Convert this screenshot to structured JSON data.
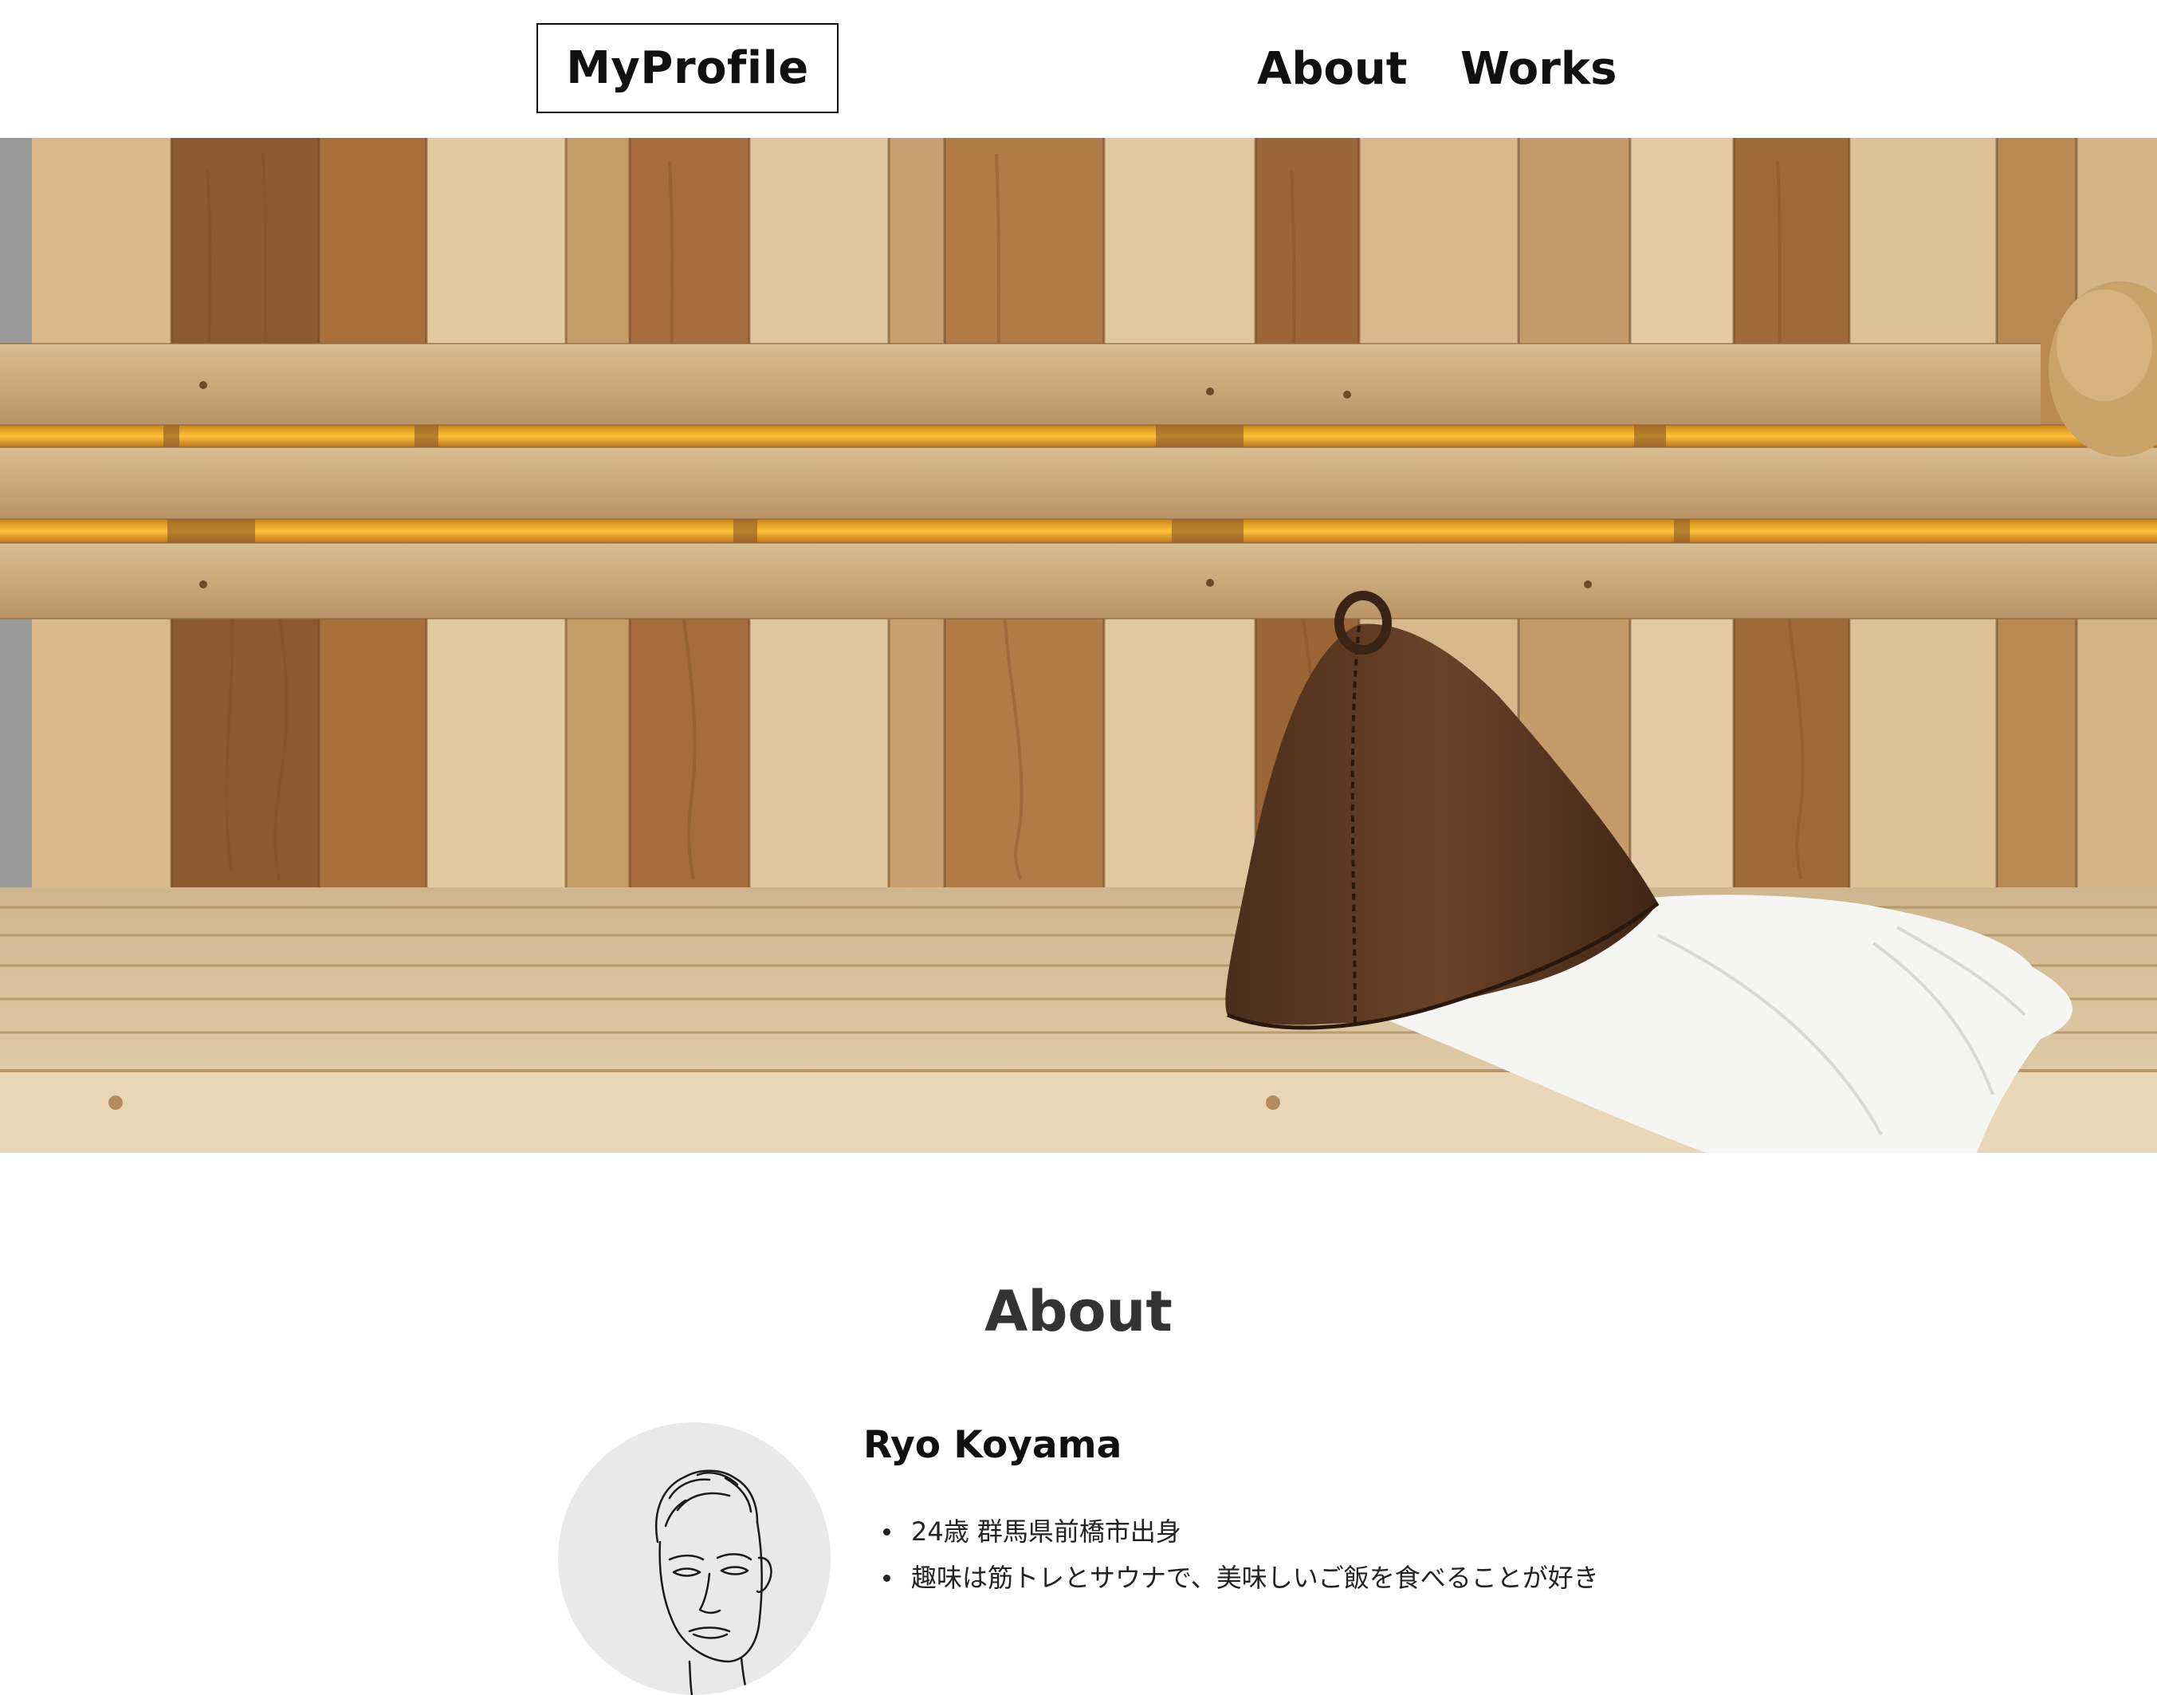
{
  "header": {
    "logo_text": "MyProfile",
    "nav": [
      {
        "label": "About"
      },
      {
        "label": "Works"
      }
    ]
  },
  "hero": {
    "subject": "sauna-bench-with-felt-hat-and-towel"
  },
  "about": {
    "title": "About",
    "name": "Ryo Koyama",
    "items": [
      "24歳 群馬県前橋市出身",
      "趣味は筋トレとサウナで、美味しいご飯を食べることが好き"
    ]
  },
  "colors": {
    "text": "#111111",
    "heading": "#333333",
    "background": "#ffffff",
    "avatar_bg": "#e9e9e9"
  }
}
